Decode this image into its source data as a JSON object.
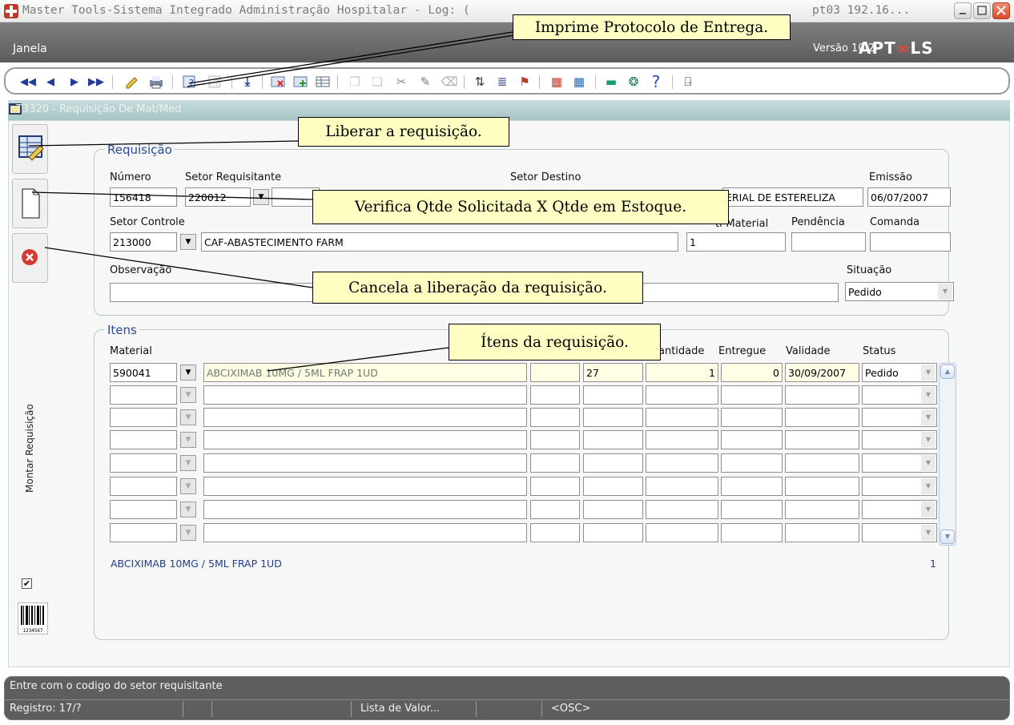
{
  "window": {
    "title": "Master Tools-Sistema Integrado Administração Hospitalar - Log: (",
    "title_tail": "pt03 192.16...",
    "version": "Versão 10.2",
    "brand": "APTOOLS",
    "brand_left": "APT",
    "brand_loop": "∞",
    "brand_right": "LS"
  },
  "menu": {
    "janela_prefix": "J",
    "janela_rest": "anela"
  },
  "form": {
    "title": "T3320 - Requisição De Mat/Med"
  },
  "requisicao": {
    "group_title": "Requisição",
    "labels": {
      "numero": "Número",
      "setor_requisitante": "Setor Requisitante",
      "setor_destino": "Setor Destino",
      "emissao": "Emissão",
      "setor_controle": "Setor Controle",
      "material_partial": "ti-Material",
      "pendencia": "Pendência",
      "comanda": "Comanda",
      "observacao": "Observação",
      "situacao": "Situação"
    },
    "numero": "156418",
    "setor_requisitante_code": "220012",
    "setor_destino_partial": "ERIAL DE ESTERELIZA",
    "emissao": "06/07/2007",
    "setor_controle_code": "213000",
    "setor_controle_name": "CAF-ABASTECIMENTO FARM",
    "tipo_material": "1",
    "pendencia": "",
    "comanda": "",
    "observacao": "",
    "situacao": "Pedido"
  },
  "itens": {
    "group_title": "Itens",
    "headers": {
      "material": "Material",
      "quantidade_partial": "antidade",
      "entregue": "Entregue",
      "validade": "Validade",
      "status": "Status"
    },
    "rows": [
      {
        "code": "590041",
        "description": "ABCIXIMAB 10MG / 5ML FRAP 1UD",
        "col_a": "",
        "col_b": "27",
        "quantidade": "1",
        "entregue": "0",
        "validade": "30/09/2007",
        "status": "Pedido"
      }
    ],
    "footer_description": "ABCIXIMAB 10MG / 5ML FRAP 1UD",
    "footer_count": "1"
  },
  "sidebar": {
    "vertical_label": "Montar Requisição",
    "barcode_digits": "1234567"
  },
  "callouts": {
    "imprime": "Imprime Protocolo de Entrega.",
    "liberar": "Liberar a requisição.",
    "verifica": "Verifica Qtde Solicitada X Qtde em Estoque.",
    "cancela": "Cancela a liberação da requisição.",
    "itens": "Ítens da requisição."
  },
  "status": {
    "message": "Entre com o codigo do setor requisitante",
    "registro": "Registro: 17/?",
    "lista_valor": "Lista de Valor...",
    "osc": "<OSC>"
  },
  "colors": {
    "menubar": "#5c5c5c",
    "accent_blue": "#2b4a99",
    "callout_bg": "#ffffc4",
    "highlight_row": "#fffde3"
  }
}
